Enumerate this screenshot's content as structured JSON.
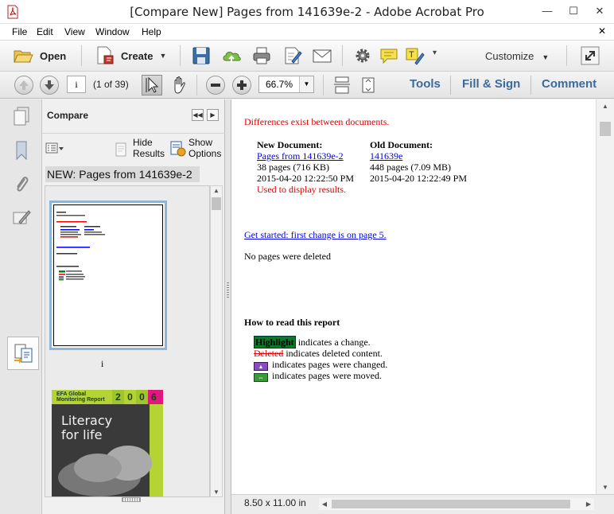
{
  "window": {
    "title": "[Compare New] Pages from 141639e-2 - Adobe Acrobat Pro",
    "min_glyph": "—",
    "max_glyph": "☐",
    "close_glyph": "✕",
    "doc_close_glyph": "✕"
  },
  "menu": [
    "File",
    "Edit",
    "View",
    "Window",
    "Help"
  ],
  "toolbar": {
    "open_label": "Open",
    "create_label": "Create",
    "create_caret": "▼",
    "customize_label": "Customize",
    "customize_caret": "▼"
  },
  "nav_toolbar": {
    "page_value": "i",
    "page_count": "(1 of 39)",
    "zoom_value": "66.7%",
    "zoom_caret": "▼",
    "tools_label": "Tools",
    "fill_sign_label": "Fill & Sign",
    "comment_label": "Comment"
  },
  "compare_panel": {
    "title": "Compare",
    "collapse_glyph": "◀◀",
    "next_glyph": "▶",
    "hide_results_label": "Hide\nResults",
    "show_options_label": "Show\nOptions",
    "doc_title": "NEW: Pages from 141639e-2",
    "thumb1_label": "i",
    "thumb2_title": "EFA Global Monitoring Report",
    "thumb2_year": [
      "2",
      "0",
      "0",
      "6"
    ],
    "thumb2_art_text": "Literacy for life",
    "scroll_up": "▲",
    "scroll_down": "▼"
  },
  "report": {
    "diff_notice": "Differences exist between documents.",
    "new_doc": {
      "heading": "New Document:",
      "name": "Pages from 141639e-2",
      "pages": "38 pages (716 KB)",
      "date": "2015-04-20 12:22:50 PM",
      "note": "Used to display results."
    },
    "old_doc": {
      "heading": "Old Document:",
      "name": "141639e",
      "pages": "448 pages (7.09 MB)",
      "date": "2015-04-20 12:22:49 PM"
    },
    "get_started": "Get started: first change is on page 5.",
    "no_deleted": "No pages were deleted",
    "how_to_heading": "How to read this report",
    "legend": {
      "highlight_word": "Highlight",
      "highlight_text": " indicates a change.",
      "deleted_word": "Deleted",
      "deleted_text": " indicates deleted content.",
      "changed_glyph": "▲",
      "changed_text": " indicates pages were changed.",
      "moved_glyph": "⇔",
      "moved_text": " indicates pages were moved."
    }
  },
  "status": {
    "page_size": "8.50 x 11.00 in",
    "scroll_up": "▲",
    "scroll_down": "▼",
    "scroll_left": "◀",
    "scroll_right": "▶"
  },
  "colors": {
    "accent_link": "#3a6a9e",
    "diff_red": "#e00000",
    "highlight_green": "#0b7a26",
    "thumb_selection": "#8fb4d6"
  }
}
